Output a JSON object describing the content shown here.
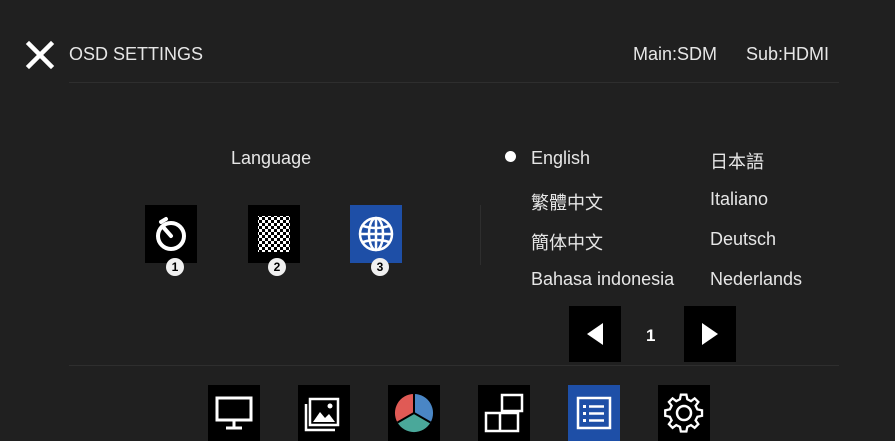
{
  "header": {
    "title": "OSD SETTINGS",
    "source_main": "Main:SDM",
    "source_sub": "Sub:HDMI",
    "close_icon": "close-icon"
  },
  "section": {
    "label": "Language",
    "tiles": [
      {
        "icon": "timer-icon",
        "badge": "1",
        "active": false
      },
      {
        "icon": "checkerboard-icon",
        "badge": "2",
        "active": false
      },
      {
        "icon": "globe-icon",
        "badge": "3",
        "active": true
      }
    ]
  },
  "languages": {
    "col1": [
      "English",
      "繁體中文",
      "簡体中文",
      "Bahasa indonesia"
    ],
    "col2": [
      "日本語",
      "Italiano",
      "Deutsch",
      "Nederlands"
    ],
    "selected": "English"
  },
  "pagination": {
    "page": "1",
    "prev_icon": "triangle-left-icon",
    "next_icon": "triangle-right-icon"
  },
  "bottom_nav": [
    {
      "icon": "monitor-icon",
      "active": false
    },
    {
      "icon": "picture-icon",
      "active": false
    },
    {
      "icon": "color-wheel-icon",
      "active": false
    },
    {
      "icon": "pip-layout-icon",
      "active": false
    },
    {
      "icon": "settings-list-icon",
      "active": true
    },
    {
      "icon": "gear-icon",
      "active": false
    }
  ],
  "colors": {
    "background": "#202020",
    "active_tile": "#1e4fa7",
    "text": "#e6e6e6"
  }
}
